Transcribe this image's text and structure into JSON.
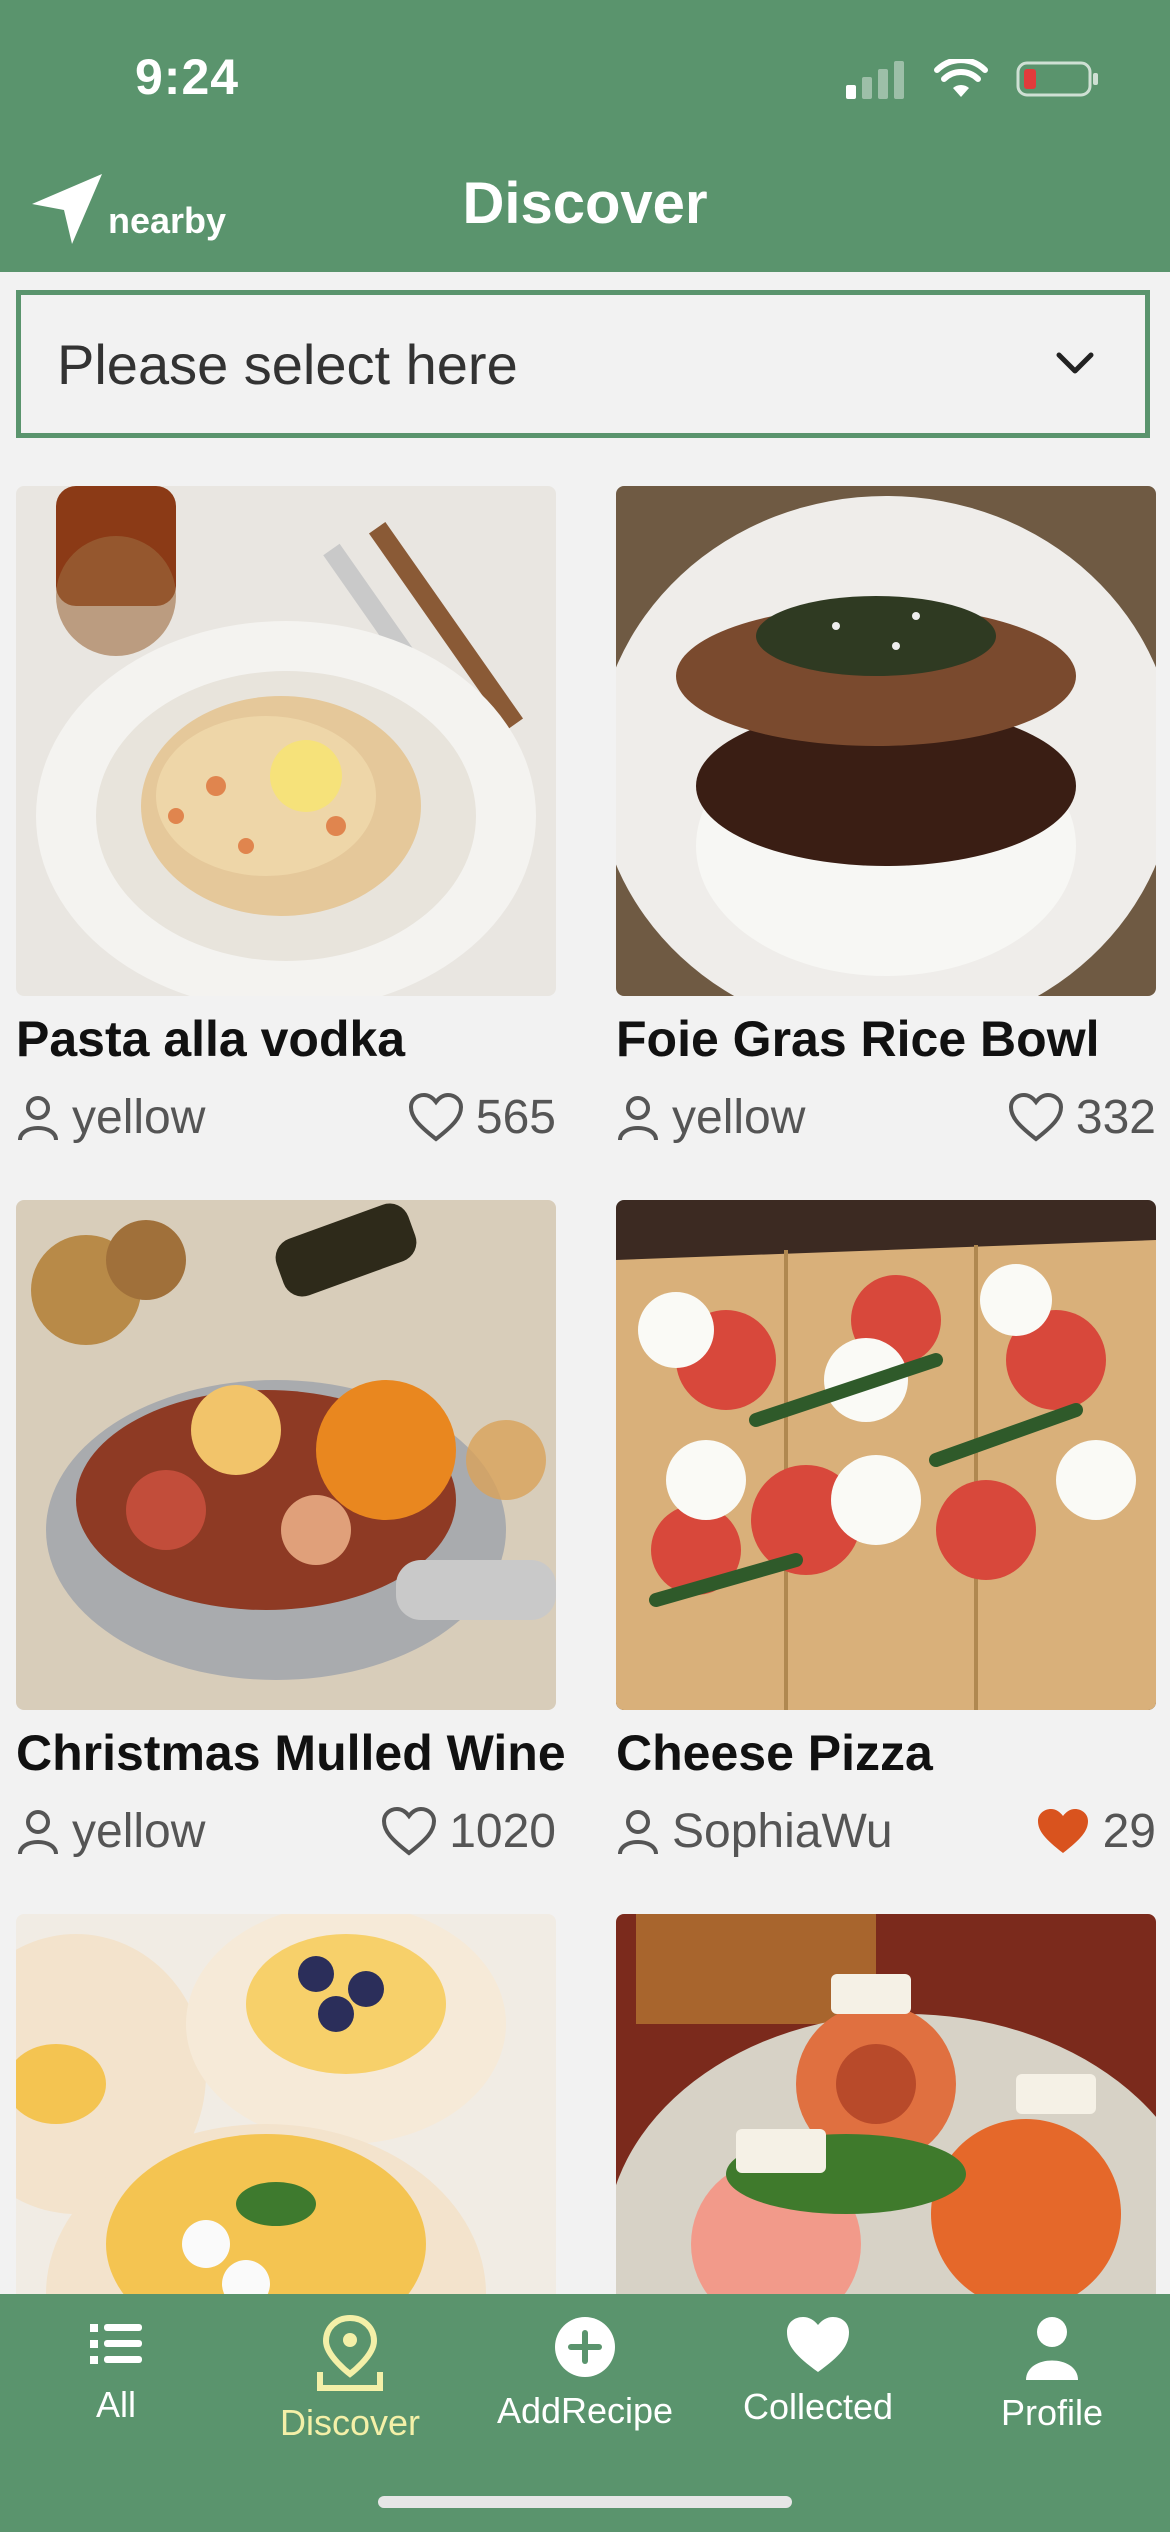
{
  "status_bar": {
    "time": "9:24"
  },
  "header": {
    "nearby_label": "nearby",
    "title": "Discover"
  },
  "select": {
    "placeholder": "Please select here"
  },
  "recipes": [
    {
      "title": "Pasta alla vodka",
      "author": "yellow",
      "likes": "565",
      "liked": false
    },
    {
      "title": "Foie Gras Rice Bowl",
      "author": "yellow",
      "likes": "332",
      "liked": false
    },
    {
      "title": "Christmas Mulled Wine",
      "author": "yellow",
      "likes": "1020",
      "liked": false
    },
    {
      "title": "Cheese Pizza",
      "author": "SophiaWu",
      "likes": "29",
      "liked": true
    },
    {
      "title": "",
      "author": "",
      "likes": "",
      "liked": false
    },
    {
      "title": "",
      "author": "",
      "likes": "",
      "liked": false
    }
  ],
  "tabs": [
    {
      "label": "All",
      "icon": "list-icon",
      "active": false
    },
    {
      "label": "Discover",
      "icon": "location-pin-icon",
      "active": true
    },
    {
      "label": "AddRecipe",
      "icon": "add-circle-icon",
      "active": false
    },
    {
      "label": "Collected",
      "icon": "heart-icon",
      "active": false
    },
    {
      "label": "Profile",
      "icon": "person-icon",
      "active": false
    }
  ],
  "colors": {
    "brand": "#5A946D",
    "active_tab": "#F4F0A8",
    "liked_heart": "#D9531E"
  }
}
